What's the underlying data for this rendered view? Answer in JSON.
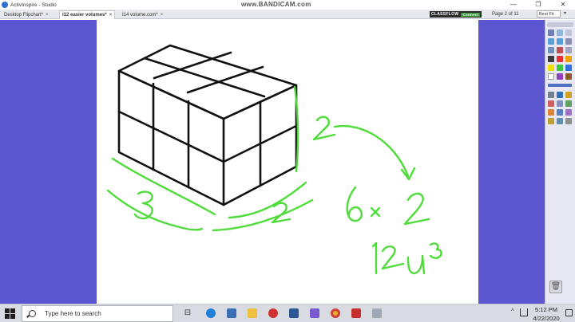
{
  "window": {
    "title": "ActivInspire - Studio",
    "watermark": "www.BANDICAM.com",
    "minimize": "—",
    "maximize": "❐",
    "close": "✕"
  },
  "tabs": [
    {
      "label": "Desktop Flipchart*",
      "active": false
    },
    {
      "label": "I12 easier volumes*",
      "active": true
    },
    {
      "label": "I14 volume.com*",
      "active": false
    }
  ],
  "toolbar": {
    "classflow_label": "CLASSFLOW",
    "classflow_status": "Connect",
    "page_indicator": "Page 2 of 11",
    "zoom_value": "Best Fit",
    "zoom_arrow": "▾"
  },
  "flipchart": {
    "ink_color": "#4fdc3a",
    "line_color": "#111111",
    "annotations": {
      "depth_dim": "2",
      "width_dim": "3",
      "length_dim": "2",
      "equation": "6×2",
      "result": "12u³"
    }
  },
  "taskbar": {
    "search_placeholder": "Type here to search",
    "time": "5:12 PM",
    "date": "4/22/2020",
    "tray_arrow": "^",
    "task_view": "⊟"
  },
  "icons": [
    "app-icon",
    "search-icon",
    "task-view-icon",
    "edge-icon",
    "store-icon",
    "file-explorer-icon",
    "recorder-icon",
    "word-icon",
    "activinspire-icon",
    "chrome-icon",
    "pdf-icon",
    "explorer-icon",
    "network-icon",
    "notification-icon",
    "trash-icon"
  ],
  "colors": {
    "margin": "#5b55d0",
    "toolbox_bg": "#e8e8f4",
    "taskbar_bg": "#d8dbe2"
  }
}
